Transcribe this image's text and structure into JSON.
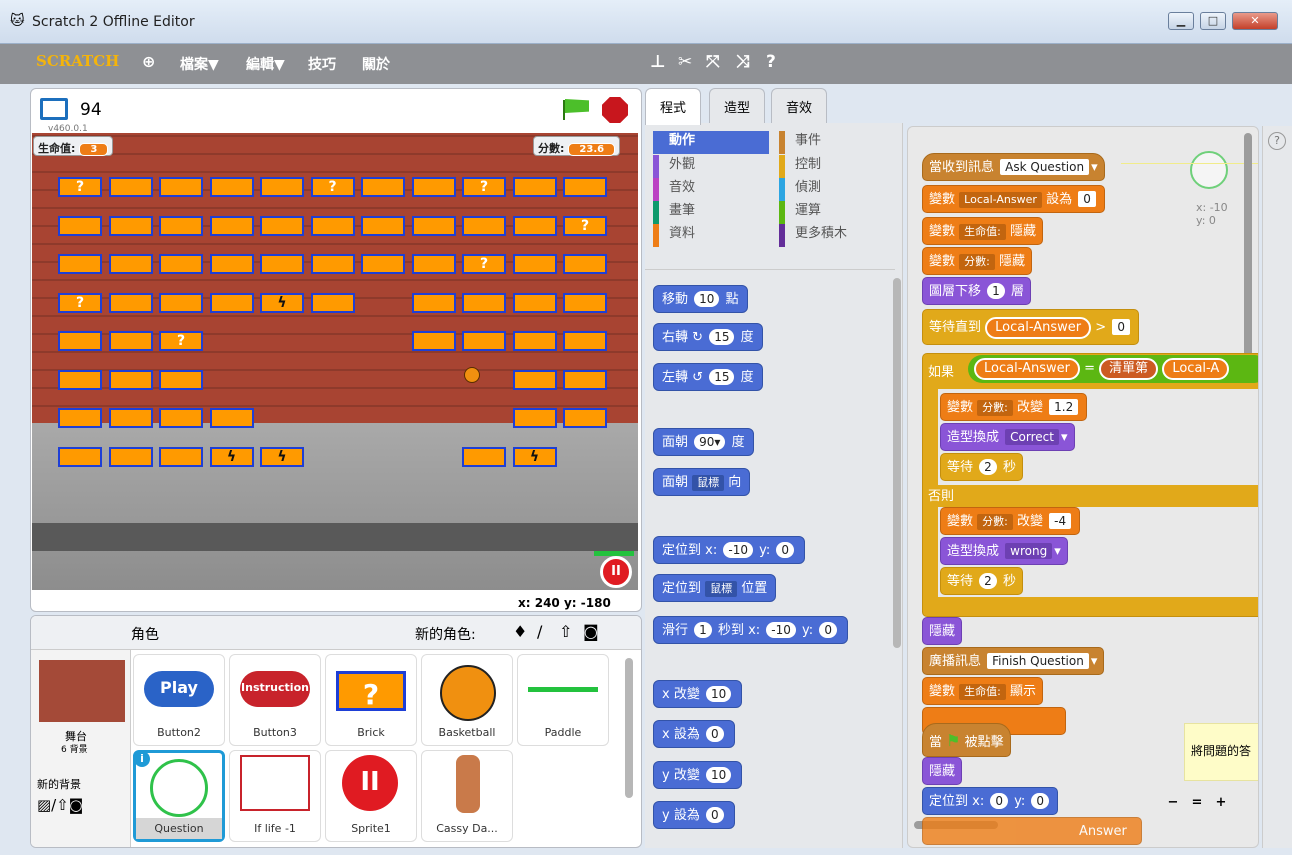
{
  "window": {
    "title": "Scratch 2 Offline Editor",
    "min": "▁",
    "max": "□",
    "close": "✕"
  },
  "menu": {
    "logo": "SCRATCH",
    "file": "檔案▼",
    "edit": "編輯▼",
    "tips": "技巧",
    "about": "關於"
  },
  "stage": {
    "project_id": "94",
    "version": "v460.0.1",
    "lives_label": "生命值:",
    "lives_value": "3",
    "score_label": "分數:",
    "score_value": "23.6",
    "mouse_x_label": "x:",
    "mouse_x": "240",
    "mouse_y_label": "y:",
    "mouse_y": "-180"
  },
  "sprites": {
    "header": "角色",
    "new_sprite_label": "新的角色:",
    "stage_name": "舞台",
    "stage_backdrops": "6 背景",
    "new_backdrop_label": "新的背景",
    "items": [
      {
        "name": "Button2",
        "art": "Play"
      },
      {
        "name": "Button3",
        "art": "Instruction"
      },
      {
        "name": "Brick",
        "art": "?"
      },
      {
        "name": "Basketball",
        "art": ""
      },
      {
        "name": "Paddle",
        "art": ""
      },
      {
        "name": "Question",
        "art": ""
      },
      {
        "name": "If life -1",
        "art": ""
      },
      {
        "name": "Sprite1",
        "art": ""
      },
      {
        "name": "Cassy Da...",
        "art": ""
      }
    ]
  },
  "tabs": {
    "code": "程式",
    "costumes": "造型",
    "sounds": "音效"
  },
  "categories": {
    "motion": "動作",
    "looks": "外觀",
    "sound": "音效",
    "pen": "畫筆",
    "data": "資料",
    "events": "事件",
    "control": "控制",
    "sensing": "偵測",
    "operators": "運算",
    "more": "更多積木"
  },
  "palette": {
    "move": "移動",
    "move_n": "10",
    "move_unit": "點",
    "turn_right": "右轉",
    "turn_right_n": "15",
    "deg": "度",
    "turn_left": "左轉",
    "turn_left_n": "15",
    "point_dir": "面朝",
    "point_dir_n": "90▾",
    "point_towards": "面朝",
    "towards_target": "鼠標",
    "towards_suffix": "向",
    "goto_xy": "定位到 x:",
    "goto_x": "-10",
    "goto_ylab": "y:",
    "goto_y": "0",
    "goto": "定位到",
    "goto_target": "鼠標",
    "goto_suffix": "位置",
    "glide": "滑行",
    "glide_n": "1",
    "glide_mid": "秒到 x:",
    "glide_x": "-10",
    "glide_ylab": "y:",
    "glide_y": "0",
    "change_x": "x 改變",
    "change_x_n": "10",
    "set_x": "x 設為",
    "set_x_n": "0",
    "change_y": "y 改變",
    "change_y_n": "10",
    "set_y": "y 設為",
    "set_y_n": "0"
  },
  "scripts": {
    "s1": "當收到訊息",
    "s1_msg": "Ask Question",
    "s2": "變數",
    "s2_var": "Local-Answer",
    "s2_set": "設為",
    "s2_val": "0",
    "s3": "變數",
    "s3_var": "生命值:",
    "s3_act": "隱藏",
    "s4": "變數",
    "s4_var": "分數:",
    "s4_act": "隱藏",
    "s5": "圖層下移",
    "s5_n": "1",
    "s5_unit": "層",
    "s6": "等待直到",
    "s6_var": "Local-Answer",
    "s6_op": ">",
    "s6_val": "0",
    "s7": "如果",
    "s7_var": "Local-Answer",
    "s7_op": "=",
    "s7_list": "清單第",
    "s7_var2": "Local-A",
    "s8": "變數",
    "s8_var": "分數:",
    "s8_act": "改變",
    "s8_val": "1.2",
    "s9": "造型換成",
    "s9_val": "Correct",
    "s10": "等待",
    "s10_n": "2",
    "s10_unit": "秒",
    "s11": "否則",
    "s12": "變數",
    "s12_var": "分數:",
    "s12_act": "改變",
    "s12_val": "-4",
    "s13": "造型換成",
    "s13_val": "wrong",
    "s14": "等待",
    "s14_n": "2",
    "s14_unit": "秒",
    "s15": "隱藏",
    "s16": "廣播訊息",
    "s16_msg": "Finish Question",
    "s17": "變數",
    "s17_var": "生命值:",
    "s17_act": "顯示",
    "s18_pre": "當",
    "s18": "被點擊",
    "s19": "隱藏",
    "s20": "定位到 x:",
    "s20_x": "0",
    "s20_ylab": "y:",
    "s20_y": "0",
    "s21_end": "Answer",
    "comment": "將問題的答",
    "coord_x": "x: -10",
    "coord_y": "y: 0",
    "zoom_out": "−",
    "zoom_reset": "=",
    "zoom_in": "+"
  },
  "help": "?"
}
